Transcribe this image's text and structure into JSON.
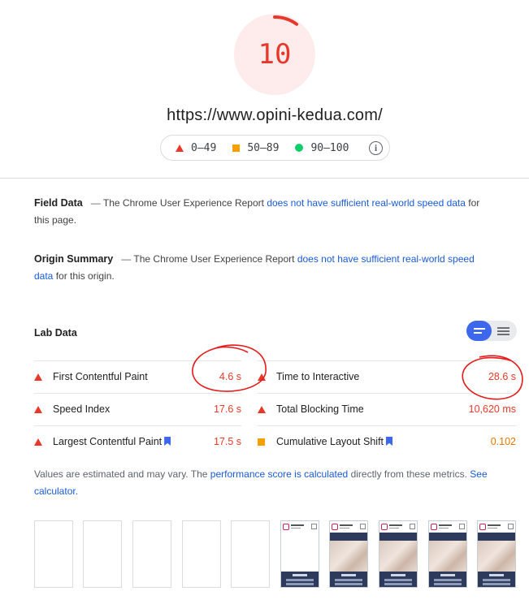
{
  "score": {
    "value": "10",
    "color": "#e8382a",
    "ring_fraction": 0.1
  },
  "url": "https://www.opini-kedua.com/",
  "legend": {
    "fail": "0–49",
    "average": "50–89",
    "pass": "90–100"
  },
  "field_data": {
    "title": "Field Data",
    "dash": "—",
    "text_before": "The Chrome User Experience Report",
    "link": "does not have sufficient real-world speed data",
    "text_after": "for this page."
  },
  "origin_summary": {
    "title": "Origin Summary",
    "dash": "—",
    "text_before": "The Chrome User Experience Report",
    "link": "does not have sufficient real-world speed data",
    "text_after": "for this origin."
  },
  "lab_data": {
    "title": "Lab Data",
    "metrics": [
      {
        "label": "First Contentful Paint",
        "value": "4.6 s",
        "status": "fail"
      },
      {
        "label": "Time to Interactive",
        "value": "28.6 s",
        "status": "fail"
      },
      {
        "label": "Speed Index",
        "value": "17.6 s",
        "status": "fail"
      },
      {
        "label": "Total Blocking Time",
        "value": "10,620 ms",
        "status": "fail"
      },
      {
        "label": "Largest Contentful Paint",
        "value": "17.5 s",
        "status": "fail"
      },
      {
        "label": "Cumulative Layout Shift",
        "value": "0.102",
        "status": "average"
      }
    ]
  },
  "note": {
    "text_before": "Values are estimated and may vary. The",
    "link1": "performance score is calculated",
    "text_middle": "directly from these metrics.",
    "link2": "See calculator."
  },
  "colors": {
    "fail": "#e8382a",
    "average": "#f5a000",
    "pass": "#0cce6b",
    "link": "#1a5ad8",
    "accent": "#3d68ee"
  }
}
